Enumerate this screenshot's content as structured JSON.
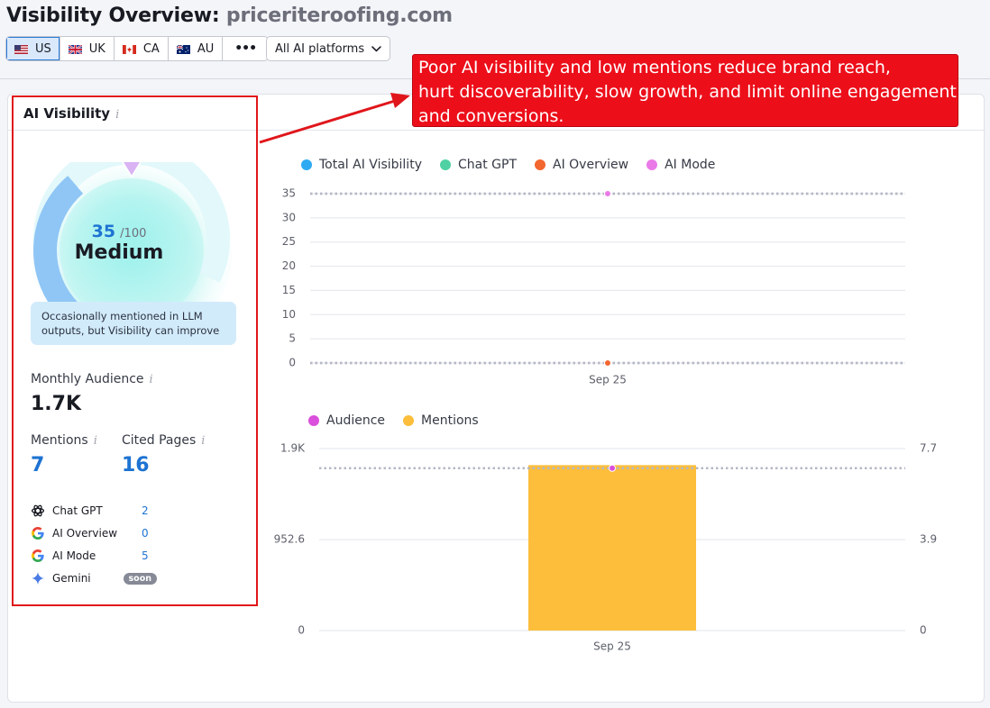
{
  "header": {
    "title": "Visibility Overview:",
    "domain": "priceriteroofing.com",
    "countries": [
      {
        "code": "US",
        "active": true
      },
      {
        "code": "UK",
        "active": false
      },
      {
        "code": "CA",
        "active": false
      },
      {
        "code": "AU",
        "active": false
      }
    ],
    "more_label": "•••",
    "platform_select": "All AI platforms"
  },
  "callout": {
    "lines": [
      "Poor AI visibility and low mentions reduce brand reach,",
      "hurt discoverability, slow growth, and limit online engagement",
      "and conversions."
    ]
  },
  "ai_visibility": {
    "title": "AI Visibility",
    "score": "35",
    "score_max": "/100",
    "level": "Medium",
    "gauge_fraction": 0.35,
    "note": "Occasionally mentioned in LLM outputs, but Visibility can improve",
    "monthly_audience_label": "Monthly Audience",
    "monthly_audience_value": "1.7K",
    "mentions_label": "Mentions",
    "mentions_value": "7",
    "cited_pages_label": "Cited Pages",
    "cited_pages_value": "16",
    "platforms": [
      {
        "name": "Chat GPT",
        "value": "2",
        "icon": "chatgpt-icon"
      },
      {
        "name": "AI Overview",
        "value": "0",
        "icon": "google-icon"
      },
      {
        "name": "AI Mode",
        "value": "5",
        "icon": "google-icon"
      },
      {
        "name": "Gemini",
        "value": "soon",
        "icon": "gemini-icon"
      }
    ]
  },
  "colors": {
    "total_ai_visibility": "#2eaaf2",
    "chat_gpt": "#4fd1a3",
    "ai_overview": "#f2662f",
    "ai_mode": "#ea7ae8",
    "audience": "#da4fdb",
    "mentions": "#fcbe3b"
  },
  "chart_data": [
    {
      "type": "line",
      "x": [
        "Sep 25"
      ],
      "yticks": [
        0,
        5,
        10,
        15,
        20,
        25,
        30,
        35
      ],
      "ylim": [
        0,
        35
      ],
      "grid": true,
      "legend": "top-left",
      "series": [
        {
          "name": "Total AI Visibility",
          "values": [
            35
          ]
        },
        {
          "name": "Chat GPT",
          "values": [
            0
          ]
        },
        {
          "name": "AI Overview",
          "values": [
            0
          ]
        },
        {
          "name": "AI Mode",
          "values": [
            35
          ]
        }
      ]
    },
    {
      "type": "bar",
      "categories": [
        "Sep 25"
      ],
      "legend": "top-left",
      "left_axis": {
        "ticks": [
          "0",
          "952.6",
          "1.9K"
        ],
        "ylim": [
          0,
          1905.2
        ]
      },
      "right_axis": {
        "ticks": [
          "0",
          "3.9",
          "7.7"
        ],
        "ylim": [
          0,
          7.7
        ]
      },
      "series": [
        {
          "name": "Audience",
          "type": "line",
          "axis": "left",
          "values": [
            1700
          ]
        },
        {
          "name": "Mentions",
          "type": "bar",
          "axis": "right",
          "values": [
            7
          ]
        }
      ]
    }
  ]
}
